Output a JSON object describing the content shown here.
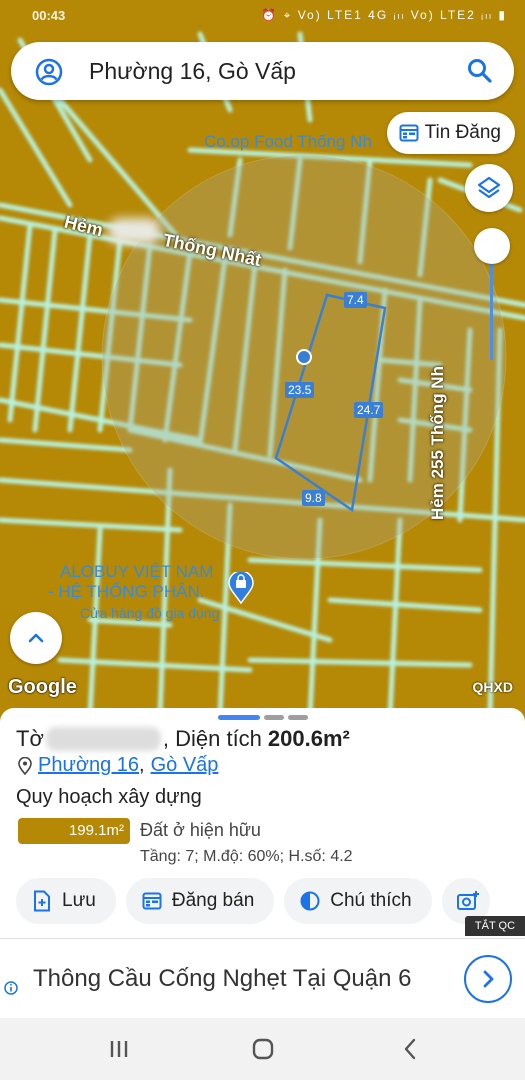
{
  "status_bar": {
    "time": "00:43",
    "icons_text": "⏰ ⌖ Vo) LTE1 4G ᵢₗₗ Vo) LTE2 ᵢₗₗ ▮"
  },
  "search": {
    "query": "Phường 16, Gò Vấp"
  },
  "buttons": {
    "tin_dang": "Tin Đăng"
  },
  "map": {
    "street_hem": "Hẻm",
    "street_thong_nhat": "Thống Nhất",
    "street_hem_255": "Hẻm 255 Thống Nh",
    "poi_coop": "Co.op Food Thống Nh",
    "poi_alobuy_1": "ALOBUY VIỆT NAM",
    "poi_alobuy_2": "- HỆ THỐNG PHÂN.",
    "poi_alobuy_sub": "Cửa hàng đồ gia dụng",
    "dimensions": [
      "7.4",
      "23.5",
      "24.7",
      "9.8"
    ],
    "google": "Google",
    "qhxd": "QHXD"
  },
  "sheet": {
    "to_label": "Tờ",
    "dien_tich_label": ", Diện tích",
    "area": "200.6m²",
    "ward": "Phường 16",
    "sep": ",",
    "district": "Gò Vấp",
    "plan_title": "Quy hoạch xây dựng",
    "plan_area": "199.1m²",
    "plan_type": "Đất ở hiện hữu",
    "plan_detail": "Tầng: 7; M.độ: 60%; H.số: 4.2",
    "actions": [
      "Lưu",
      "Đăng bán",
      "Chú thích"
    ],
    "handle_colors": [
      "#4285f4",
      "#9e9e9e",
      "#9e9e9e"
    ]
  },
  "ad": {
    "badge": "TẮT QC",
    "text": "Thông Cầu Cống Nghẹt Tại Quận 6"
  },
  "colors": {
    "map_bg": "#b58806",
    "road_glow": "#a8f0e0",
    "accent_blue": "#1a73e8"
  }
}
